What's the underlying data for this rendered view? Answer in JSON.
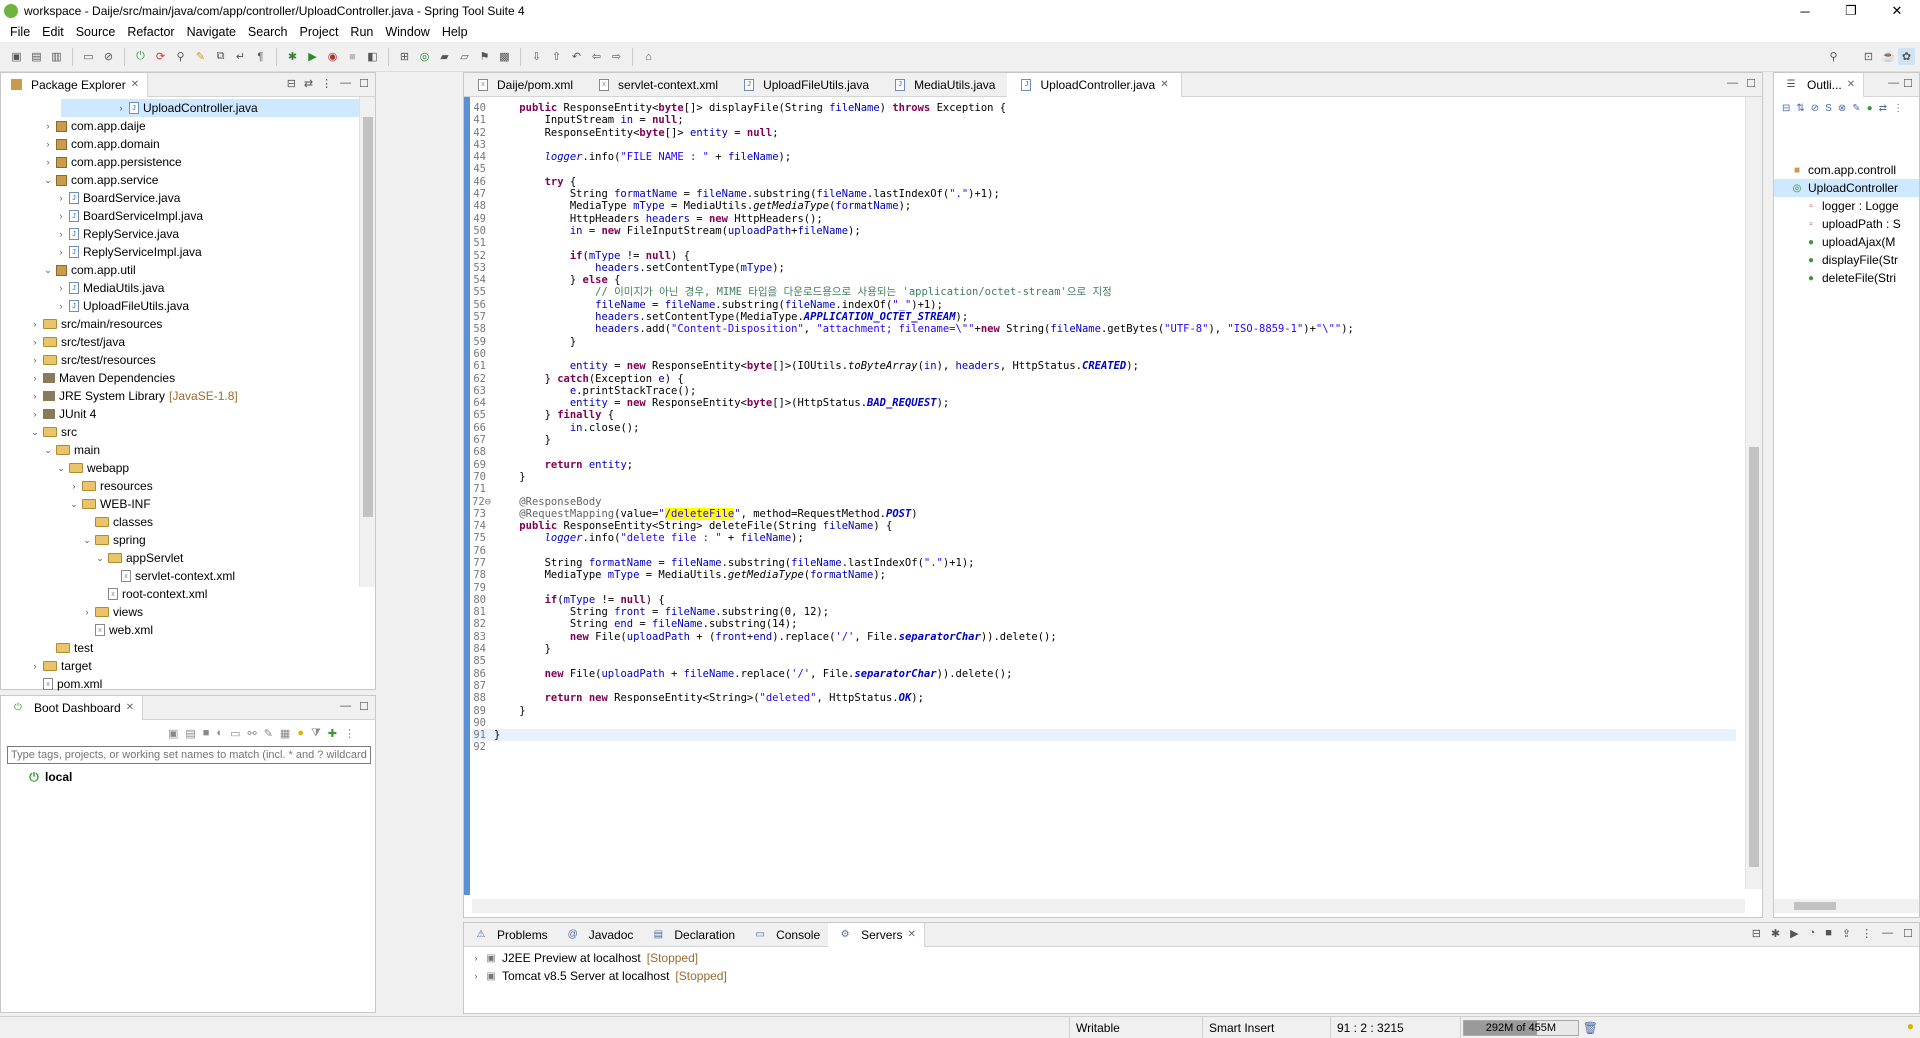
{
  "window": {
    "title": "workspace - Daije/src/main/java/com/app/controller/UploadController.java - Spring Tool Suite 4",
    "minimize": "─",
    "maximize": "❐",
    "close": "✕"
  },
  "menu": [
    "File",
    "Edit",
    "Source",
    "Refactor",
    "Navigate",
    "Search",
    "Project",
    "Run",
    "Window",
    "Help"
  ],
  "package_explorer": {
    "title": "Package Explorer",
    "items": [
      {
        "label": "UploadController.java",
        "indent": 4,
        "twisty": "›",
        "icon": "java",
        "selected": true
      },
      {
        "label": "com.app.daije",
        "indent": 3,
        "twisty": "›",
        "icon": "package"
      },
      {
        "label": "com.app.domain",
        "indent": 3,
        "twisty": "›",
        "icon": "package"
      },
      {
        "label": "com.app.persistence",
        "indent": 3,
        "twisty": "›",
        "icon": "package"
      },
      {
        "label": "com.app.service",
        "indent": 3,
        "twisty": "⌄",
        "icon": "package"
      },
      {
        "label": "BoardService.java",
        "indent": 4,
        "twisty": "›",
        "icon": "java"
      },
      {
        "label": "BoardServiceImpl.java",
        "indent": 4,
        "twisty": "›",
        "icon": "java"
      },
      {
        "label": "ReplyService.java",
        "indent": 4,
        "twisty": "›",
        "icon": "java"
      },
      {
        "label": "ReplyServiceImpl.java",
        "indent": 4,
        "twisty": "›",
        "icon": "java"
      },
      {
        "label": "com.app.util",
        "indent": 3,
        "twisty": "⌄",
        "icon": "package"
      },
      {
        "label": "MediaUtils.java",
        "indent": 4,
        "twisty": "›",
        "icon": "java"
      },
      {
        "label": "UploadFileUtils.java",
        "indent": 4,
        "twisty": "›",
        "icon": "java"
      },
      {
        "label": "src/main/resources",
        "indent": 2,
        "twisty": "›",
        "icon": "folder"
      },
      {
        "label": "src/test/java",
        "indent": 2,
        "twisty": "›",
        "icon": "folder"
      },
      {
        "label": "src/test/resources",
        "indent": 2,
        "twisty": "›",
        "icon": "folder"
      },
      {
        "label": "Maven Dependencies",
        "indent": 2,
        "twisty": "›",
        "icon": "jar"
      },
      {
        "label": "JRE System Library",
        "suffix": "[JavaSE-1.8]",
        "indent": 2,
        "twisty": "›",
        "icon": "jar"
      },
      {
        "label": "JUnit 4",
        "indent": 2,
        "twisty": "›",
        "icon": "jar"
      },
      {
        "label": "src",
        "indent": 2,
        "twisty": "⌄",
        "icon": "folder"
      },
      {
        "label": "main",
        "indent": 3,
        "twisty": "⌄",
        "icon": "folder"
      },
      {
        "label": "webapp",
        "indent": 4,
        "twisty": "⌄",
        "icon": "folder"
      },
      {
        "label": "resources",
        "indent": 5,
        "twisty": "›",
        "icon": "folder"
      },
      {
        "label": "WEB-INF",
        "indent": 5,
        "twisty": "⌄",
        "icon": "folder"
      },
      {
        "label": "classes",
        "indent": 6,
        "twisty": "",
        "icon": "folder"
      },
      {
        "label": "spring",
        "indent": 6,
        "twisty": "⌄",
        "icon": "folder"
      },
      {
        "label": "appServlet",
        "indent": 7,
        "twisty": "⌄",
        "icon": "folder"
      },
      {
        "label": "servlet-context.xml",
        "indent": 8,
        "twisty": "",
        "icon": "xml"
      },
      {
        "label": "root-context.xml",
        "indent": 7,
        "twisty": "",
        "icon": "xml"
      },
      {
        "label": "views",
        "indent": 6,
        "twisty": "›",
        "icon": "folder"
      },
      {
        "label": "web.xml",
        "indent": 6,
        "twisty": "",
        "icon": "xml"
      },
      {
        "label": "test",
        "indent": 3,
        "twisty": "",
        "icon": "folder"
      },
      {
        "label": "target",
        "indent": 2,
        "twisty": "›",
        "icon": "folder"
      },
      {
        "label": "pom.xml",
        "indent": 2,
        "twisty": "",
        "icon": "xml"
      }
    ]
  },
  "boot_dashboard": {
    "title": "Boot Dashboard",
    "filter_placeholder": "Type tags, projects, or working set names to match (incl. * and ? wildcards)",
    "local": "local"
  },
  "editor": {
    "tabs": [
      {
        "label": "Daije/pom.xml"
      },
      {
        "label": "servlet-context.xml"
      },
      {
        "label": "UploadFileUtils.java"
      },
      {
        "label": "MediaUtils.java"
      },
      {
        "label": "UploadController.java",
        "active": true
      }
    ],
    "lines": [
      {
        "n": "40",
        "c": "    <k>public</k> ResponseEntity&lt;<k>byte</k>[]&gt; displayFile(String <f>fileName</f>) <k>throws</k> Exception {"
      },
      {
        "n": "41",
        "c": "        InputStream <f>in</f> = <k>null</k>;"
      },
      {
        "n": "42",
        "c": "        ResponseEntity&lt;<k>byte</k>[]&gt; <f>entity</f> = <k>null</k>;"
      },
      {
        "n": "43",
        "c": ""
      },
      {
        "n": "44",
        "c": "        <f><i>logger</i></f>.info(<s>\"FILE NAME : \"</s> + <f>fileName</f>);"
      },
      {
        "n": "45",
        "c": ""
      },
      {
        "n": "46",
        "c": "        <k>try</k> {"
      },
      {
        "n": "47",
        "c": "            String <f>formatName</f> = <f>fileName</f>.substring(<f>fileName</f>.lastIndexOf(<s>\".\"</s>)+1);"
      },
      {
        "n": "48",
        "c": "            MediaType <f>mType</f> = MediaUtils.<i>getMediaType</i>(<f>formatName</f>);"
      },
      {
        "n": "49",
        "c": "            HttpHeaders <f>headers</f> = <k>new</k> HttpHeaders();"
      },
      {
        "n": "50",
        "c": "            <f>in</f> = <k>new</k> FileInputStream(<f>uploadPath</f>+<f>fileName</f>);"
      },
      {
        "n": "51",
        "c": ""
      },
      {
        "n": "52",
        "c": "            <k>if</k>(<f>mType</f> != <k>null</k>) {"
      },
      {
        "n": "53",
        "c": "                <f>headers</f>.setContentType(<f>mType</f>);"
      },
      {
        "n": "54",
        "c": "            } <k>else</k> {"
      },
      {
        "n": "55",
        "c": "                <c>// 이미지가 아닌 경우, MIME 타입을 다운로드용으로 사용되는 'application/octet-stream'으로 지정</c>"
      },
      {
        "n": "56",
        "c": "                <f>fileName</f> = <f>fileName</f>.substring(<f>fileName</f>.indexOf(<s>\"_\"</s>)+1);"
      },
      {
        "n": "57",
        "c": "                <f>headers</f>.setContentType(MediaType.<b>APPLICATION_OCTET_STREAM</b>);"
      },
      {
        "n": "58",
        "c": "                <f>headers</f>.add(<s>\"Content-Disposition\"</s>, <s>\"attachment; filename=\\\"\"</s>+<k>new</k> String(<f>fileName</f>.getBytes(<s>\"UTF-8\"</s>), <s>\"ISO-8859-1\"</s>)+<s>\"\\\"\"</s>);"
      },
      {
        "n": "59",
        "c": "            }"
      },
      {
        "n": "60",
        "c": ""
      },
      {
        "n": "61",
        "c": "            <f>entity</f> = <k>new</k> ResponseEntity&lt;<k>byte</k>[]&gt;(IOUtils.<i>toByteArray</i>(<f>in</f>), <f>headers</f>, HttpStatus.<b>CREATED</b>);"
      },
      {
        "n": "62",
        "c": "        } <k>catch</k>(Exception <f>e</f>) {"
      },
      {
        "n": "63",
        "c": "            <f>e</f>.printStackTrace();"
      },
      {
        "n": "64",
        "c": "            <f>entity</f> = <k>new</k> ResponseEntity&lt;<k>byte</k>[]&gt;(HttpStatus.<b>BAD_REQUEST</b>);"
      },
      {
        "n": "65",
        "c": "        } <k>finally</k> {"
      },
      {
        "n": "66",
        "c": "            <f>in</f>.close();"
      },
      {
        "n": "67",
        "c": "        }"
      },
      {
        "n": "68",
        "c": ""
      },
      {
        "n": "69",
        "c": "        <k>return</k> <f>entity</f>;"
      },
      {
        "n": "70",
        "c": "    }"
      },
      {
        "n": "71",
        "c": ""
      },
      {
        "n": "72⊖",
        "c": "    <a>@ResponseBody</a>"
      },
      {
        "n": "73",
        "c": "    <a>@RequestMapping</a>(value=<s>\"<h>/deleteFile</h>\"</s>, method=RequestMethod.<b>POST</b>)"
      },
      {
        "n": "74",
        "c": "    <k>public</k> ResponseEntity&lt;String&gt; deleteFile(String <f>fileName</f>) {"
      },
      {
        "n": "75",
        "c": "        <f><i>logger</i></f>.info(<s>\"delete file : \"</s> + <f>fileName</f>);"
      },
      {
        "n": "76",
        "c": ""
      },
      {
        "n": "77",
        "c": "        String <f>formatName</f> = <f>fileName</f>.substring(<f>fileName</f>.lastIndexOf(<s>\".\"</s>)+1);"
      },
      {
        "n": "78",
        "c": "        MediaType <f>mType</f> = MediaUtils.<i>getMediaType</i>(<f>formatName</f>);"
      },
      {
        "n": "79",
        "c": ""
      },
      {
        "n": "80",
        "c": "        <k>if</k>(<f>mType</f> != <k>null</k>) {"
      },
      {
        "n": "81",
        "c": "            String <f>front</f> = <f>fileName</f>.substring(0, 12);"
      },
      {
        "n": "82",
        "c": "            String <f>end</f> = <f>fileName</f>.substring(14);"
      },
      {
        "n": "83",
        "c": "            <k>new</k> File(<f>uploadPath</f> + (<f>front</f>+<f>end</f>).replace(<s>'/'</s>, File.<b>separatorChar</b>)).delete();"
      },
      {
        "n": "84",
        "c": "        }"
      },
      {
        "n": "85",
        "c": ""
      },
      {
        "n": "86",
        "c": "        <k>new</k> File(<f>uploadPath</f> + <f>fileName</f>.replace(<s>'/'</s>, File.<b>separatorChar</b>)).delete();"
      },
      {
        "n": "87",
        "c": ""
      },
      {
        "n": "88",
        "c": "        <k>return</k> <k>new</k> ResponseEntity&lt;String&gt;(<s>\"deleted\"</s>, HttpStatus.<b>OK</b>);"
      },
      {
        "n": "89",
        "c": "    }"
      },
      {
        "n": "90",
        "c": ""
      },
      {
        "n": "91",
        "c": "}",
        "current": true
      },
      {
        "n": "92",
        "c": ""
      }
    ]
  },
  "outline": {
    "title": "Outli...",
    "items": [
      {
        "label": "com.app.controll",
        "indent": 1,
        "icon": "package"
      },
      {
        "label": "UploadController",
        "indent": 1,
        "icon": "class",
        "selected": true
      },
      {
        "label": "logger : Logge",
        "indent": 2,
        "icon": "sf"
      },
      {
        "label": "uploadPath : S",
        "indent": 2,
        "icon": "priv"
      },
      {
        "label": "uploadAjax(M",
        "indent": 2,
        "icon": "pub"
      },
      {
        "label": "displayFile(Str",
        "indent": 2,
        "icon": "pub"
      },
      {
        "label": "deleteFile(Stri",
        "indent": 2,
        "icon": "pub"
      }
    ]
  },
  "bottom": {
    "tabs": [
      {
        "label": "Problems"
      },
      {
        "label": "Javadoc"
      },
      {
        "label": "Declaration"
      },
      {
        "label": "Console"
      },
      {
        "label": "Servers",
        "active": true
      }
    ],
    "servers": [
      {
        "name": "J2EE Preview at localhost",
        "state": "[Stopped]"
      },
      {
        "name": "Tomcat v8.5 Server at localhost",
        "state": "[Stopped]"
      }
    ]
  },
  "status": {
    "writable": "Writable",
    "insert": "Smart Insert",
    "position": "91 : 2 : 3215",
    "heap": "292M of 455M",
    "heap_used_fraction": 0.64
  },
  "colors": {
    "keyword": "#7f0055",
    "string": "#2a00ff",
    "field": "#0000c0",
    "comment": "#3f7f5f",
    "annotation": "#646464",
    "highlight": "#ffff00",
    "selection": "#cde8ff",
    "spring_green": "#6db33f"
  }
}
